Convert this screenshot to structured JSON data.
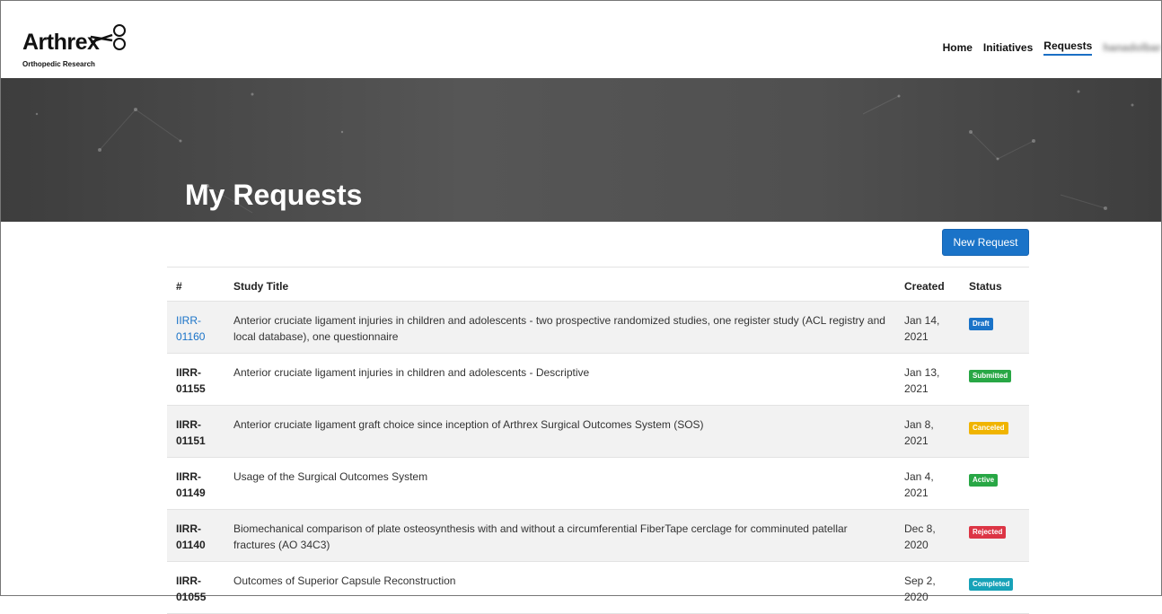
{
  "brand": {
    "name": "Arthrex",
    "subtitle": "Orthopedic Research"
  },
  "nav": {
    "items": [
      {
        "label": "Home"
      },
      {
        "label": "Initiatives"
      },
      {
        "label": "Requests",
        "active": true
      }
    ],
    "user": "hanadolbar"
  },
  "hero": {
    "title": "My Requests"
  },
  "actions": {
    "new_request": "New Request"
  },
  "table": {
    "columns": {
      "id": "#",
      "title": "Study Title",
      "created": "Created",
      "status": "Status"
    },
    "rows": [
      {
        "id_line1": "IIRR-",
        "id_line2": "01160",
        "title": "Anterior cruciate ligament injuries in children and adolescents - two prospective randomized studies, one register study (ACL registry and local database), one questionnaire",
        "created_line1": "Jan 14,",
        "created_line2": "2021",
        "status": "Draft",
        "status_color": "#1a73c8",
        "link": true
      },
      {
        "id_line1": "IIRR-",
        "id_line2": "01155",
        "title": "Anterior cruciate ligament injuries in children and adolescents - Descriptive",
        "created_line1": "Jan 13,",
        "created_line2": "2021",
        "status": "Submitted",
        "status_color": "#28a745"
      },
      {
        "id_line1": "IIRR-",
        "id_line2": "01151",
        "title": "Anterior cruciate ligament graft choice since inception of Arthrex Surgical Outcomes System (SOS)",
        "created_line1": "Jan 8,",
        "created_line2": "2021",
        "status": "Canceled",
        "status_color": "#f0b400"
      },
      {
        "id_line1": "IIRR-",
        "id_line2": "01149",
        "title": "Usage of the Surgical Outcomes System",
        "created_line1": "Jan 4,",
        "created_line2": "2021",
        "status": "Active",
        "status_color": "#28a745"
      },
      {
        "id_line1": "IIRR-",
        "id_line2": "01140",
        "title": "Biomechanical comparison of plate osteosynthesis with and without a circumferential FiberTape cerclage for comminuted patellar fractures (AO 34C3)",
        "created_line1": "Dec 8,",
        "created_line2": "2020",
        "status": "Rejected",
        "status_color": "#dc3545"
      },
      {
        "id_line1": "IIRR-",
        "id_line2": "01055",
        "title": "Outcomes of Superior Capsule Reconstruction",
        "created_line1": "Sep 2,",
        "created_line2": "2020",
        "status": "Completed",
        "status_color": "#17a2b8"
      }
    ]
  }
}
